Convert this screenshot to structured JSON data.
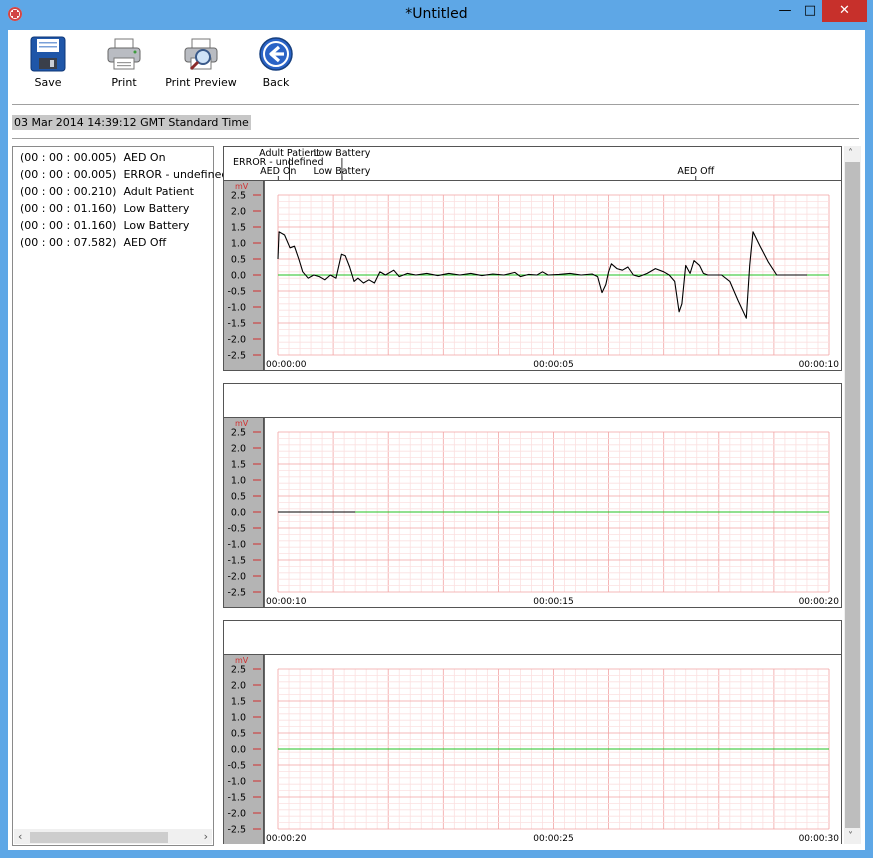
{
  "window": {
    "title": "*Untitled",
    "minimize": "—",
    "maximize": "□",
    "close": "✕",
    "app_icon": "medical-cross-icon"
  },
  "toolbar": {
    "save": {
      "label": "Save",
      "icon": "floppy-disk-icon"
    },
    "print": {
      "label": "Print",
      "icon": "printer-icon"
    },
    "print_preview": {
      "label": "Print Preview",
      "icon": "print-preview-icon"
    },
    "back": {
      "label": "Back",
      "icon": "back-arrow-icon"
    }
  },
  "timestamp": "03 Mar 2014 14:39:12 GMT Standard Time",
  "events": [
    {
      "time": "(00 : 00 : 00.005)",
      "label": "AED On"
    },
    {
      "time": "(00 : 00 : 00.005)",
      "label": "ERROR - undefined"
    },
    {
      "time": "(00 : 00 : 00.210)",
      "label": "Adult Patient"
    },
    {
      "time": "(00 : 00 : 01.160)",
      "label": "Low Battery"
    },
    {
      "time": "(00 : 00 : 01.160)",
      "label": "Low Battery"
    },
    {
      "time": "(00 : 00 : 07.582)",
      "label": "AED Off"
    }
  ],
  "chart_data": [
    {
      "type": "line",
      "ylabel": "mV",
      "ylim": [
        -2.5,
        2.5
      ],
      "yticks": [
        2.5,
        2.0,
        1.5,
        1.0,
        0.5,
        0.0,
        -0.5,
        -1.0,
        -1.5,
        -2.0,
        -2.5
      ],
      "xlim": [
        0,
        10
      ],
      "xticks": [
        {
          "t": 0,
          "label": "00:00:00"
        },
        {
          "t": 5,
          "label": "00:00:05"
        },
        {
          "t": 10,
          "label": "00:00:10"
        }
      ],
      "markers": [
        {
          "t": 0.005,
          "label": "AED On",
          "row": "bottom"
        },
        {
          "t": 0.005,
          "label": "ERROR - undefined",
          "row": "middle"
        },
        {
          "t": 0.21,
          "label": "Adult Patient",
          "row": "top"
        },
        {
          "t": 1.16,
          "label": "Low Battery",
          "row": "top"
        },
        {
          "t": 1.16,
          "label": "Low Battery",
          "row": "bottom"
        },
        {
          "t": 7.582,
          "label": "AED Off",
          "row": "bottom"
        }
      ],
      "series": [
        {
          "color": "#000000",
          "points": [
            [
              0.0,
              0.5
            ],
            [
              0.02,
              1.35
            ],
            [
              0.12,
              1.25
            ],
            [
              0.22,
              0.85
            ],
            [
              0.3,
              0.9
            ],
            [
              0.38,
              0.5
            ],
            [
              0.45,
              0.1
            ],
            [
              0.55,
              -0.1
            ],
            [
              0.65,
              0.0
            ],
            [
              0.75,
              -0.05
            ],
            [
              0.85,
              -0.15
            ],
            [
              0.95,
              0.0
            ],
            [
              1.05,
              -0.1
            ],
            [
              1.15,
              0.65
            ],
            [
              1.22,
              0.6
            ],
            [
              1.3,
              0.25
            ],
            [
              1.38,
              -0.2
            ],
            [
              1.45,
              -0.1
            ],
            [
              1.55,
              -0.25
            ],
            [
              1.65,
              -0.15
            ],
            [
              1.75,
              -0.25
            ],
            [
              1.85,
              0.1
            ],
            [
              1.95,
              0.0
            ],
            [
              2.1,
              0.15
            ],
            [
              2.2,
              -0.05
            ],
            [
              2.35,
              0.05
            ],
            [
              2.5,
              0.0
            ],
            [
              2.7,
              0.05
            ],
            [
              2.9,
              -0.02
            ],
            [
              3.1,
              0.05
            ],
            [
              3.3,
              0.0
            ],
            [
              3.5,
              0.05
            ],
            [
              3.7,
              -0.02
            ],
            [
              3.9,
              0.03
            ],
            [
              4.1,
              0.0
            ],
            [
              4.3,
              0.08
            ],
            [
              4.4,
              -0.05
            ],
            [
              4.55,
              0.02
            ],
            [
              4.7,
              0.0
            ],
            [
              4.8,
              0.1
            ],
            [
              4.9,
              0.0
            ],
            [
              5.1,
              0.02
            ],
            [
              5.3,
              0.05
            ],
            [
              5.5,
              0.0
            ],
            [
              5.7,
              0.03
            ],
            [
              5.8,
              -0.05
            ],
            [
              5.88,
              -0.55
            ],
            [
              5.95,
              -0.3
            ],
            [
              6.0,
              0.1
            ],
            [
              6.05,
              0.35
            ],
            [
              6.15,
              0.2
            ],
            [
              6.25,
              0.15
            ],
            [
              6.35,
              0.25
            ],
            [
              6.45,
              0.0
            ],
            [
              6.55,
              -0.05
            ],
            [
              6.7,
              0.05
            ],
            [
              6.85,
              0.2
            ],
            [
              7.0,
              0.1
            ],
            [
              7.1,
              0.0
            ],
            [
              7.2,
              -0.2
            ],
            [
              7.28,
              -1.15
            ],
            [
              7.33,
              -0.9
            ],
            [
              7.4,
              0.3
            ],
            [
              7.48,
              0.05
            ],
            [
              7.55,
              0.45
            ],
            [
              7.65,
              0.3
            ],
            [
              7.72,
              0.05
            ],
            [
              7.8,
              0.0
            ],
            [
              8.05,
              0.0
            ],
            [
              8.2,
              -0.2
            ],
            [
              8.35,
              -0.8
            ],
            [
              8.5,
              -1.35
            ],
            [
              8.56,
              0.3
            ],
            [
              8.62,
              1.35
            ],
            [
              8.75,
              0.9
            ],
            [
              8.9,
              0.4
            ],
            [
              9.05,
              0.0
            ],
            [
              9.6,
              0.0
            ]
          ]
        }
      ]
    },
    {
      "type": "line",
      "ylabel": "mV",
      "ylim": [
        -2.5,
        2.5
      ],
      "yticks": [
        2.5,
        2.0,
        1.5,
        1.0,
        0.5,
        0.0,
        -0.5,
        -1.0,
        -1.5,
        -2.0,
        -2.5
      ],
      "xlim": [
        10,
        20
      ],
      "xticks": [
        {
          "t": 10,
          "label": "00:00:10"
        },
        {
          "t": 15,
          "label": "00:00:15"
        },
        {
          "t": 20,
          "label": "00:00:20"
        }
      ],
      "markers": [],
      "series": [
        {
          "color": "#000000",
          "points": [
            [
              10.0,
              0.0
            ],
            [
              11.4,
              0.0
            ]
          ]
        }
      ]
    },
    {
      "type": "line",
      "ylabel": "mV",
      "ylim": [
        -2.5,
        2.5
      ],
      "yticks": [
        2.5,
        2.0,
        1.5,
        1.0,
        0.5,
        0.0,
        -0.5,
        -1.0,
        -1.5,
        -2.0,
        -2.5
      ],
      "xlim": [
        20,
        30
      ],
      "xticks": [
        {
          "t": 20,
          "label": "00:00:20"
        },
        {
          "t": 25,
          "label": "00:00:25"
        },
        {
          "t": 30,
          "label": "00:00:30"
        }
      ],
      "markers": [],
      "series": []
    }
  ],
  "colors": {
    "grid_major": "#f2a3a3",
    "grid_minor": "#fbe0e0",
    "baseline": "#22c022",
    "axis_label": "#d03030",
    "scale_bg": "#b4b4b4"
  }
}
